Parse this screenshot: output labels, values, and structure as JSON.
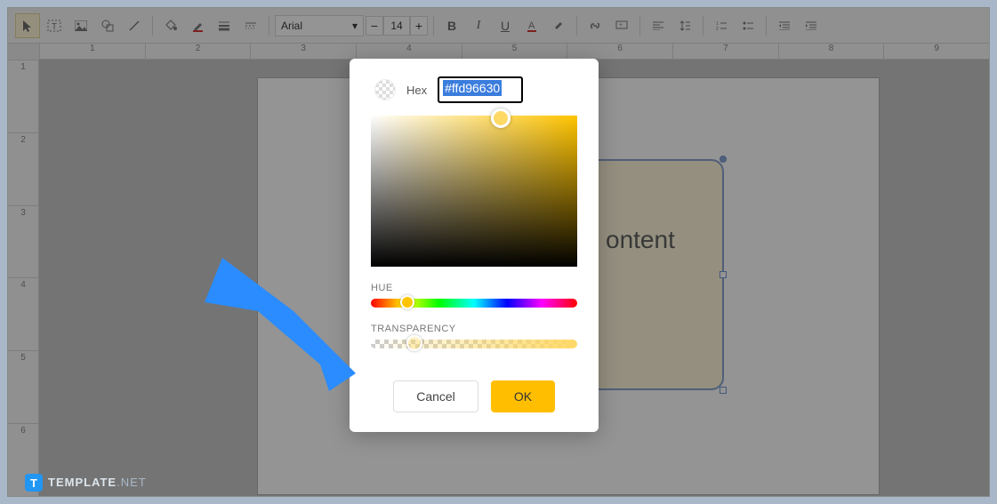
{
  "toolbar": {
    "font_name": "Arial",
    "font_size": "14",
    "bold": "B",
    "italic": "I",
    "underline": "U"
  },
  "ruler_h": [
    "1",
    "2",
    "3",
    "4",
    "5",
    "6",
    "7",
    "8",
    "9"
  ],
  "ruler_v": [
    "1",
    "2",
    "3",
    "4",
    "5",
    "6"
  ],
  "shape_text": "ontent",
  "colorpicker": {
    "hex_label": "Hex",
    "hex_value": "#ffd96630",
    "hue_label": "HUE",
    "transparency_label": "TRANSPARENCY",
    "cancel": "Cancel",
    "ok": "OK"
  },
  "watermark": {
    "icon": "T",
    "bold": "TEMPLATE",
    "light": ".NET"
  }
}
